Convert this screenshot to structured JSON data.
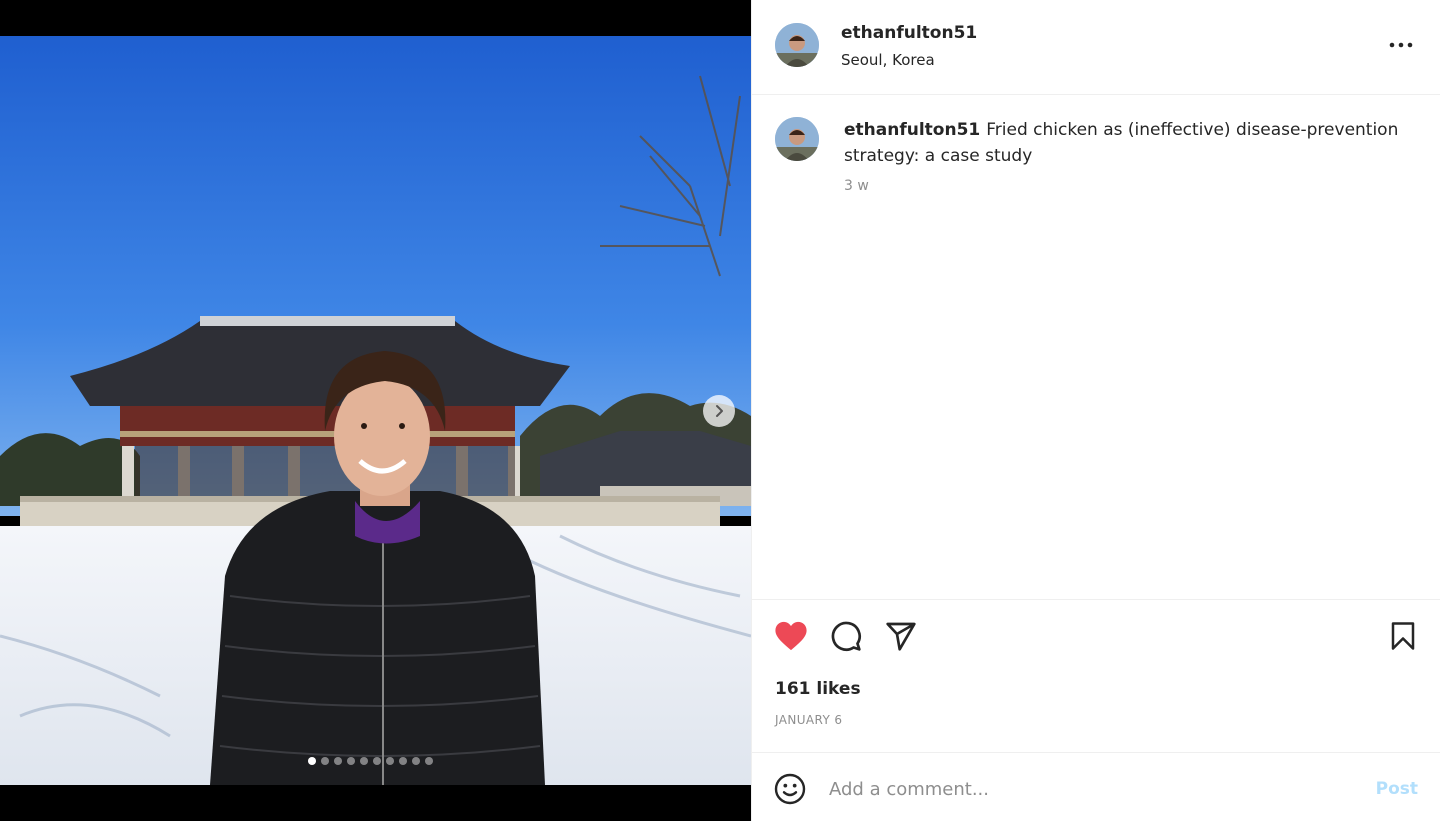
{
  "post": {
    "username": "ethanfulton51",
    "location": "Seoul, Korea",
    "caption": "Fried chicken as (ineffective) disease-prevention strategy: a case study",
    "time_ago": "3 w",
    "likes": "161 likes",
    "date": "JANUARY 6"
  },
  "carousel": {
    "total_slides": 10,
    "current_slide": 1
  },
  "comment": {
    "placeholder": "Add a comment...",
    "post_label": "Post"
  },
  "colors": {
    "like": "#ed4956",
    "post_disabled": "#b2dffc",
    "text": "#262626",
    "muted": "#8e8e8e"
  },
  "icons": [
    "more-options-icon",
    "heart-icon",
    "comment-icon",
    "share-icon",
    "bookmark-icon",
    "emoji-icon",
    "chevron-right-icon"
  ]
}
